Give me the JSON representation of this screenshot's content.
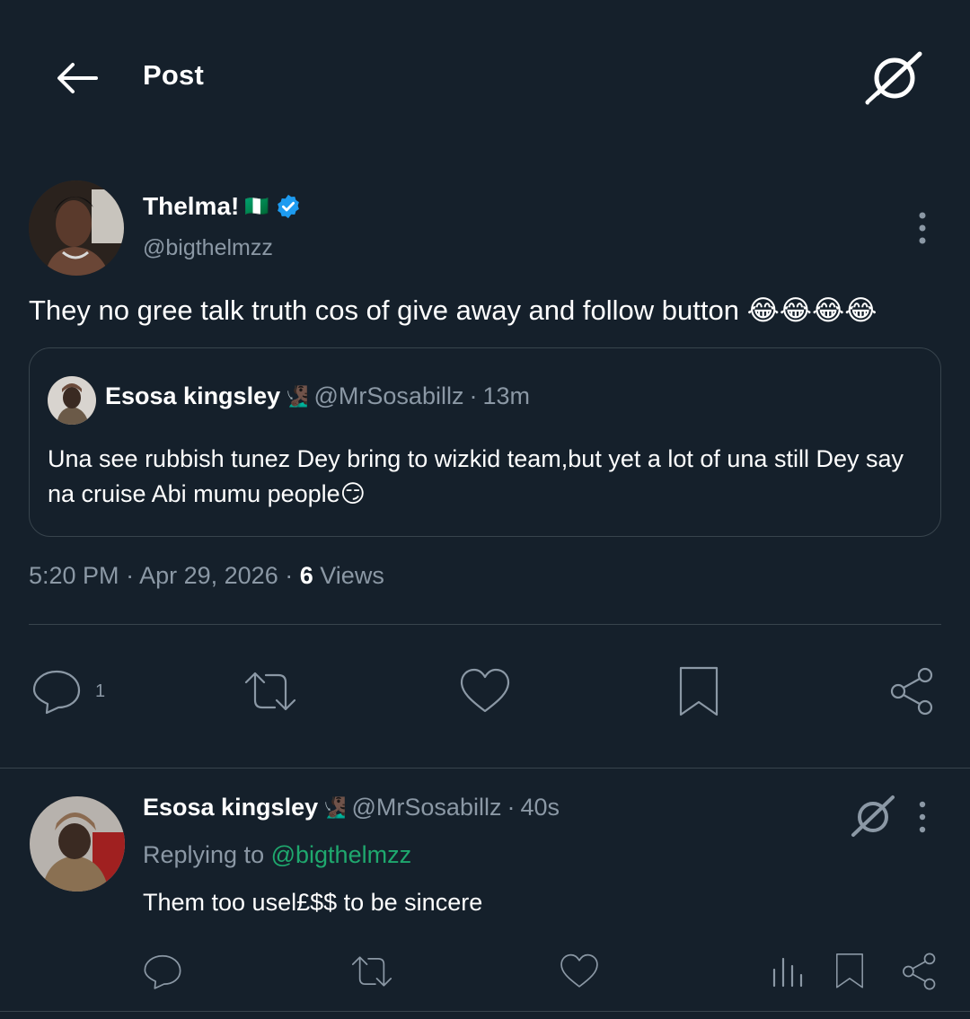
{
  "header": {
    "title": "Post"
  },
  "tweet": {
    "author_name": "Thelma!",
    "author_flag": "🇳🇬",
    "author_handle": "@bigthelmzz",
    "text": "They no gree talk truth cos of give away and follow button 😂😂😂😂",
    "quote": {
      "author_name": "Esosa kingsley",
      "author_emoji": "🧏🏿‍♂️",
      "author_handle": "@MrSosabillz",
      "time": "13m",
      "text": "Una see rubbish tunez Dey bring to wizkid team,but yet a lot of una still Dey say na cruise Abi mumu people😏"
    },
    "time": "5:20 PM",
    "date": "Apr 29, 2026",
    "views_count": "6",
    "views_label": "Views",
    "reply_count": "1"
  },
  "reply": {
    "author_name": "Esosa kingsley",
    "author_emoji": "🧏🏿‍♂️",
    "author_handle": "@MrSosabillz",
    "time": "40s",
    "replying_to_label": "Replying to",
    "replying_to_handle": "@bigthelmzz",
    "text": "Them too usel£$$ to be sincere"
  },
  "colors": {
    "background": "#15202b",
    "muted": "#8b98a5",
    "divider": "#38444d",
    "verified": "#1d9bf0",
    "mention": "#1fa86e"
  }
}
